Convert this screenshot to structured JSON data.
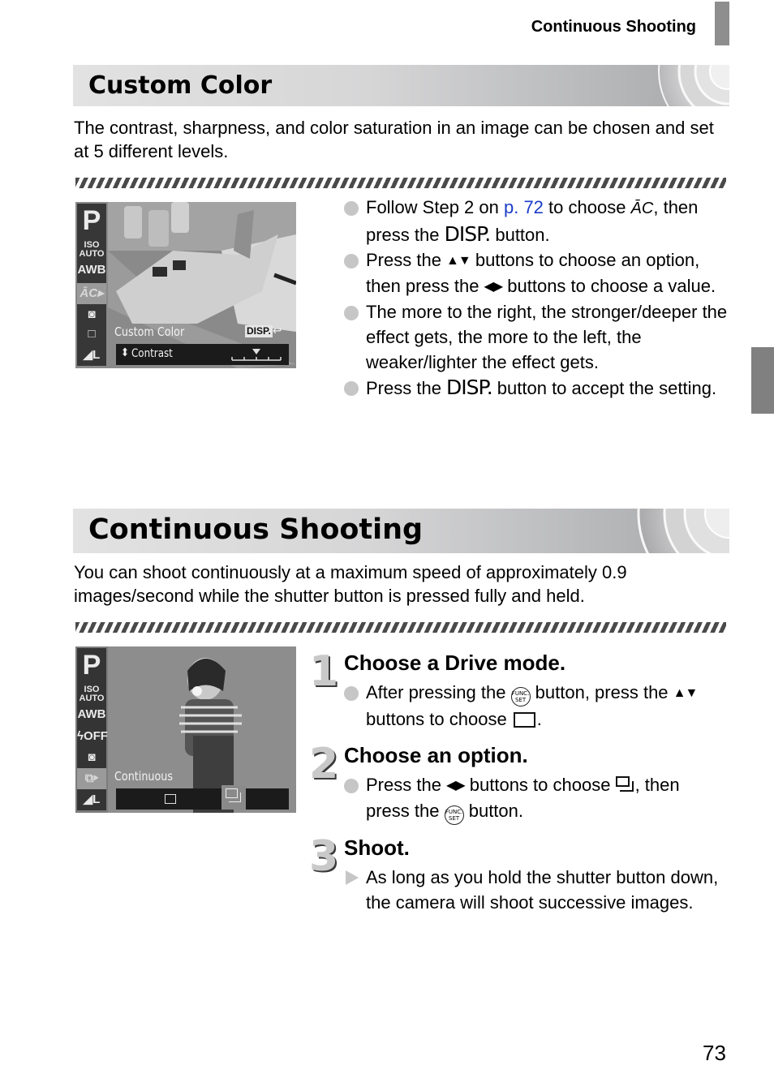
{
  "header": {
    "running_title": "Continuous Shooting",
    "page_number": "73"
  },
  "colors": {
    "link": "#1a3cc8",
    "tab_gray": "#808080",
    "bullet_gray": "#c6c6c6",
    "hatch": "#4a4a4a"
  },
  "custom_color": {
    "title": "Custom Color",
    "intro": "The contrast, sharpness, and color saturation in an image can be chosen and set at 5 different levels.",
    "screen": {
      "sidebar_icons": [
        "P",
        "ISO AUTO",
        "AWB",
        "custom-color-icon",
        "metering-icon",
        "drive-single-icon",
        "image-size-L-icon"
      ],
      "menu_label": "Custom Color",
      "disp_badge": "DISP.",
      "return_icon": "return-arrow-icon",
      "option_label": "Contrast",
      "slider_level": 3,
      "slider_levels": 5
    },
    "bullets": [
      {
        "pre": "Follow Step 2 on ",
        "link": "p. 72",
        "mid": " to choose ",
        "icon": "custom-color-icon",
        "icon_glyph": "ĀC",
        "post": ", then press the ",
        "disp": "DISP.",
        "end": " button."
      },
      {
        "pre": "Press the ",
        "arrows": "▲▼",
        "mid": " buttons to choose an option, then press the ",
        "arrows2": "◀▶",
        "end": " buttons to choose a value."
      },
      {
        "text": "The more to the right, the stronger/deeper the effect gets, the more to the left, the weaker/lighter the effect gets."
      },
      {
        "pre": "Press the ",
        "disp": "DISP.",
        "end": " button to accept the setting."
      }
    ]
  },
  "continuous_shooting": {
    "title": "Continuous Shooting",
    "intro": "You can shoot continuously at a maximum speed of approximately 0.9 images/second while the shutter button is pressed fully and held.",
    "screen": {
      "sidebar_icons": [
        "P",
        "ISO AUTO",
        "AWB",
        "flash-off-icon",
        "metering-icon",
        "drive-continuous-icon",
        "image-size-L-icon"
      ],
      "menu_label": "Continuous",
      "options": [
        "single-shot-icon",
        "continuous-icon"
      ],
      "selected_option": "continuous-icon"
    },
    "steps": [
      {
        "number": "1",
        "title": "Choose a Drive mode.",
        "bullet": {
          "pre": "After pressing the ",
          "func": "FUNC. SET",
          "mid": " button, press the ",
          "arrows": "▲▼",
          "end": " buttons to choose ",
          "post": "."
        }
      },
      {
        "number": "2",
        "title": "Choose an option.",
        "bullet": {
          "pre": "Press the ",
          "arrows": "◀▶",
          "mid": " buttons to choose ",
          "post": ", then press the ",
          "func": "FUNC. SET",
          "end": " button."
        }
      },
      {
        "number": "3",
        "title": "Shoot.",
        "bullet": {
          "text": "As long as you hold the shutter button down, the camera will shoot successive images."
        }
      }
    ]
  }
}
